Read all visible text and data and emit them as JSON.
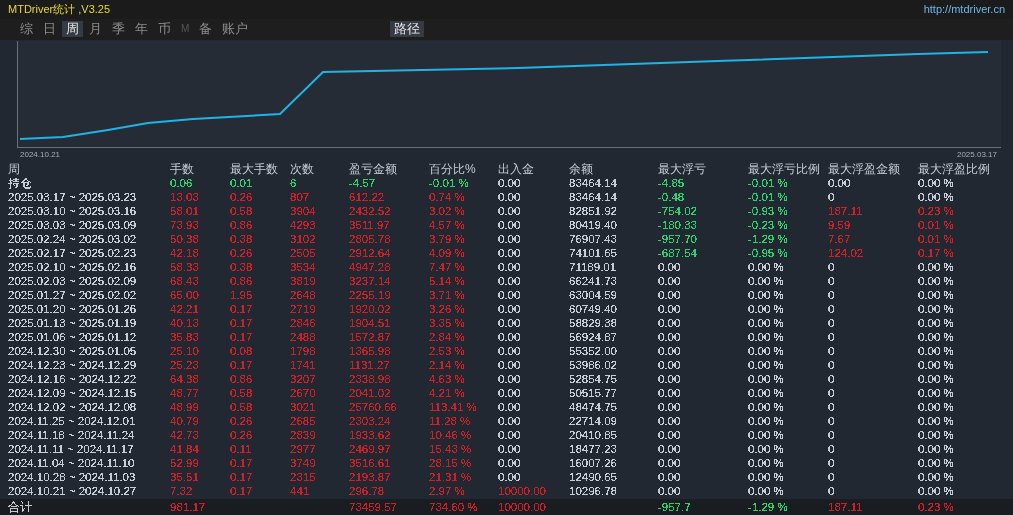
{
  "window": {
    "title": "MTDriver统计 ,V3.25",
    "link": "http://mtdriver.cn"
  },
  "tabs": [
    {
      "label": "综",
      "selected": false,
      "disabled": false
    },
    {
      "label": "日",
      "selected": false,
      "disabled": false
    },
    {
      "label": "周",
      "selected": true,
      "disabled": false
    },
    {
      "label": "月",
      "selected": false,
      "disabled": false
    },
    {
      "label": "季",
      "selected": false,
      "disabled": false
    },
    {
      "label": "年",
      "selected": false,
      "disabled": false
    },
    {
      "label": "币",
      "selected": false,
      "disabled": false
    },
    {
      "label": "M",
      "selected": false,
      "disabled": true
    },
    {
      "label": "备",
      "selected": false,
      "disabled": false
    },
    {
      "label": "账户",
      "selected": false,
      "disabled": false
    }
  ],
  "path_button": "路径",
  "chart": {
    "start_label": "2024.10.21",
    "end_label": "2025.03.17"
  },
  "table": {
    "columns": [
      "周",
      "手数",
      "最大手数",
      "次数",
      "盈亏金额",
      "百分比%",
      "出入金",
      "余额",
      "最大浮亏",
      "最大浮亏比例",
      "最大浮盈金额",
      "最大浮盈比例"
    ],
    "rows": [
      {
        "cells": [
          {
            "text": "持仓",
            "color": "#c8ccd4"
          },
          {
            "text": "0.06",
            "color": "#2ed16a"
          },
          {
            "text": "0.01",
            "color": "#2ed16a"
          },
          {
            "text": "6",
            "color": "#2ed16a"
          },
          {
            "text": "-4.57",
            "color": "#2ed16a"
          },
          {
            "text": "-0.01 %",
            "color": "#2ed16a"
          },
          {
            "text": "0.00",
            "color": "#c8ccd4"
          },
          {
            "text": "83464.14",
            "color": "#c8ccd4"
          },
          {
            "text": "-4.85",
            "color": "#2ed16a"
          },
          {
            "text": "-0.01 %",
            "color": "#2ed16a"
          },
          {
            "text": "0.00",
            "color": "#c8ccd4"
          },
          {
            "text": "0.00 %",
            "color": "#c8ccd4"
          }
        ]
      },
      {
        "cells": [
          {
            "text": "2025.03.17 ~ 2025.03.23",
            "color": "#c8ccd4"
          },
          {
            "text": "13.03",
            "color": "#cf2028"
          },
          {
            "text": "0.26",
            "color": "#cf2028"
          },
          {
            "text": "807",
            "color": "#cf2028"
          },
          {
            "text": "612.22",
            "color": "#cf2028"
          },
          {
            "text": "0.74 %",
            "color": "#cf2028"
          },
          {
            "text": "0.00",
            "color": "#c8ccd4"
          },
          {
            "text": "83464.14",
            "color": "#c8ccd4"
          },
          {
            "text": "-0.48",
            "color": "#2ed16a"
          },
          {
            "text": "-0.01 %",
            "color": "#2ed16a"
          },
          {
            "text": "0",
            "color": "#c8ccd4"
          },
          {
            "text": "0.00 %",
            "color": "#c8ccd4"
          }
        ]
      },
      {
        "cells": [
          {
            "text": "2025.03.10 ~ 2025.03.16",
            "color": "#c8ccd4"
          },
          {
            "text": "58.01",
            "color": "#cf2028"
          },
          {
            "text": "0.58",
            "color": "#cf2028"
          },
          {
            "text": "3904",
            "color": "#cf2028"
          },
          {
            "text": "2432.52",
            "color": "#cf2028"
          },
          {
            "text": "3.02 %",
            "color": "#cf2028"
          },
          {
            "text": "0.00",
            "color": "#c8ccd4"
          },
          {
            "text": "82851.92",
            "color": "#c8ccd4"
          },
          {
            "text": "-754.02",
            "color": "#2ed16a"
          },
          {
            "text": "-0.93 %",
            "color": "#2ed16a"
          },
          {
            "text": "187.11",
            "color": "#cf2028"
          },
          {
            "text": "0.23 %",
            "color": "#cf2028"
          }
        ]
      },
      {
        "cells": [
          {
            "text": "2025.03.03 ~ 2025.03.09",
            "color": "#c8ccd4"
          },
          {
            "text": "73.93",
            "color": "#cf2028"
          },
          {
            "text": "0.86",
            "color": "#cf2028"
          },
          {
            "text": "4293",
            "color": "#cf2028"
          },
          {
            "text": "3511.97",
            "color": "#cf2028"
          },
          {
            "text": "4.57 %",
            "color": "#cf2028"
          },
          {
            "text": "0.00",
            "color": "#c8ccd4"
          },
          {
            "text": "80419.40",
            "color": "#c8ccd4"
          },
          {
            "text": "-180.33",
            "color": "#2ed16a"
          },
          {
            "text": "-0.23 %",
            "color": "#2ed16a"
          },
          {
            "text": "9.59",
            "color": "#cf2028"
          },
          {
            "text": "0.01 %",
            "color": "#cf2028"
          }
        ]
      },
      {
        "cells": [
          {
            "text": "2025.02.24 ~ 2025.03.02",
            "color": "#c8ccd4"
          },
          {
            "text": "50.38",
            "color": "#cf2028"
          },
          {
            "text": "0.38",
            "color": "#cf2028"
          },
          {
            "text": "3102",
            "color": "#cf2028"
          },
          {
            "text": "2805.78",
            "color": "#cf2028"
          },
          {
            "text": "3.79 %",
            "color": "#cf2028"
          },
          {
            "text": "0.00",
            "color": "#c8ccd4"
          },
          {
            "text": "76907.43",
            "color": "#c8ccd4"
          },
          {
            "text": "-957.70",
            "color": "#2ed16a"
          },
          {
            "text": "-1.29 %",
            "color": "#2ed16a"
          },
          {
            "text": "7.67",
            "color": "#cf2028"
          },
          {
            "text": "0.01 %",
            "color": "#cf2028"
          }
        ]
      },
      {
        "cells": [
          {
            "text": "2025.02.17 ~ 2025.02.23",
            "color": "#c8ccd4"
          },
          {
            "text": "42.18",
            "color": "#cf2028"
          },
          {
            "text": "0.26",
            "color": "#cf2028"
          },
          {
            "text": "2505",
            "color": "#cf2028"
          },
          {
            "text": "2912.64",
            "color": "#cf2028"
          },
          {
            "text": "4.09 %",
            "color": "#cf2028"
          },
          {
            "text": "0.00",
            "color": "#c8ccd4"
          },
          {
            "text": "74101.65",
            "color": "#c8ccd4"
          },
          {
            "text": "-687.54",
            "color": "#2ed16a"
          },
          {
            "text": "-0.95 %",
            "color": "#2ed16a"
          },
          {
            "text": "124.02",
            "color": "#cf2028"
          },
          {
            "text": "0.17 %",
            "color": "#cf2028"
          }
        ]
      },
      {
        "cells": [
          {
            "text": "2025.02.10 ~ 2025.02.16",
            "color": "#c8ccd4"
          },
          {
            "text": "58.33",
            "color": "#cf2028"
          },
          {
            "text": "0.38",
            "color": "#cf2028"
          },
          {
            "text": "3534",
            "color": "#cf2028"
          },
          {
            "text": "4947.28",
            "color": "#cf2028"
          },
          {
            "text": "7.47 %",
            "color": "#cf2028"
          },
          {
            "text": "0.00",
            "color": "#c8ccd4"
          },
          {
            "text": "71189.01",
            "color": "#c8ccd4"
          },
          {
            "text": "0.00",
            "color": "#c8ccd4"
          },
          {
            "text": "0.00 %",
            "color": "#c8ccd4"
          },
          {
            "text": "0",
            "color": "#c8ccd4"
          },
          {
            "text": "0.00 %",
            "color": "#c8ccd4"
          }
        ]
      },
      {
        "cells": [
          {
            "text": "2025.02.03 ~ 2025.02.09",
            "color": "#c8ccd4"
          },
          {
            "text": "68.43",
            "color": "#cf2028"
          },
          {
            "text": "0.86",
            "color": "#cf2028"
          },
          {
            "text": "3819",
            "color": "#cf2028"
          },
          {
            "text": "3237.14",
            "color": "#cf2028"
          },
          {
            "text": "5.14 %",
            "color": "#cf2028"
          },
          {
            "text": "0.00",
            "color": "#c8ccd4"
          },
          {
            "text": "66241.73",
            "color": "#c8ccd4"
          },
          {
            "text": "0.00",
            "color": "#c8ccd4"
          },
          {
            "text": "0.00 %",
            "color": "#c8ccd4"
          },
          {
            "text": "0",
            "color": "#c8ccd4"
          },
          {
            "text": "0.00 %",
            "color": "#c8ccd4"
          }
        ]
      },
      {
        "cells": [
          {
            "text": "2025.01.27 ~ 2025.02.02",
            "color": "#c8ccd4"
          },
          {
            "text": "65.00",
            "color": "#cf2028"
          },
          {
            "text": "1.95",
            "color": "#cf2028"
          },
          {
            "text": "2648",
            "color": "#cf2028"
          },
          {
            "text": "2255.19",
            "color": "#cf2028"
          },
          {
            "text": "3.71 %",
            "color": "#cf2028"
          },
          {
            "text": "0.00",
            "color": "#c8ccd4"
          },
          {
            "text": "63004.59",
            "color": "#c8ccd4"
          },
          {
            "text": "0.00",
            "color": "#c8ccd4"
          },
          {
            "text": "0.00 %",
            "color": "#c8ccd4"
          },
          {
            "text": "0",
            "color": "#c8ccd4"
          },
          {
            "text": "0.00 %",
            "color": "#c8ccd4"
          }
        ]
      },
      {
        "cells": [
          {
            "text": "2025.01.20 ~ 2025.01.26",
            "color": "#c8ccd4"
          },
          {
            "text": "42.21",
            "color": "#cf2028"
          },
          {
            "text": "0.17",
            "color": "#cf2028"
          },
          {
            "text": "2719",
            "color": "#cf2028"
          },
          {
            "text": "1920.02",
            "color": "#cf2028"
          },
          {
            "text": "3.26 %",
            "color": "#cf2028"
          },
          {
            "text": "0.00",
            "color": "#c8ccd4"
          },
          {
            "text": "60749.40",
            "color": "#c8ccd4"
          },
          {
            "text": "0.00",
            "color": "#c8ccd4"
          },
          {
            "text": "0.00 %",
            "color": "#c8ccd4"
          },
          {
            "text": "0",
            "color": "#c8ccd4"
          },
          {
            "text": "0.00 %",
            "color": "#c8ccd4"
          }
        ]
      },
      {
        "cells": [
          {
            "text": "2025.01.13 ~ 2025.01.19",
            "color": "#c8ccd4"
          },
          {
            "text": "40.13",
            "color": "#cf2028"
          },
          {
            "text": "0.17",
            "color": "#cf2028"
          },
          {
            "text": "2846",
            "color": "#cf2028"
          },
          {
            "text": "1904.51",
            "color": "#cf2028"
          },
          {
            "text": "3.35 %",
            "color": "#cf2028"
          },
          {
            "text": "0.00",
            "color": "#c8ccd4"
          },
          {
            "text": "58829.38",
            "color": "#c8ccd4"
          },
          {
            "text": "0.00",
            "color": "#c8ccd4"
          },
          {
            "text": "0.00 %",
            "color": "#c8ccd4"
          },
          {
            "text": "0",
            "color": "#c8ccd4"
          },
          {
            "text": "0.00 %",
            "color": "#c8ccd4"
          }
        ]
      },
      {
        "cells": [
          {
            "text": "2025.01.06 ~ 2025.01.12",
            "color": "#c8ccd4"
          },
          {
            "text": "35.83",
            "color": "#cf2028"
          },
          {
            "text": "0.17",
            "color": "#cf2028"
          },
          {
            "text": "2488",
            "color": "#cf2028"
          },
          {
            "text": "1572.87",
            "color": "#cf2028"
          },
          {
            "text": "2.84 %",
            "color": "#cf2028"
          },
          {
            "text": "0.00",
            "color": "#c8ccd4"
          },
          {
            "text": "56924.87",
            "color": "#c8ccd4"
          },
          {
            "text": "0.00",
            "color": "#c8ccd4"
          },
          {
            "text": "0.00 %",
            "color": "#c8ccd4"
          },
          {
            "text": "0",
            "color": "#c8ccd4"
          },
          {
            "text": "0.00 %",
            "color": "#c8ccd4"
          }
        ]
      },
      {
        "cells": [
          {
            "text": "2024.12.30 ~ 2025.01.05",
            "color": "#c8ccd4"
          },
          {
            "text": "25.10",
            "color": "#cf2028"
          },
          {
            "text": "0.08",
            "color": "#cf2028"
          },
          {
            "text": "1798",
            "color": "#cf2028"
          },
          {
            "text": "1365.98",
            "color": "#cf2028"
          },
          {
            "text": "2.53 %",
            "color": "#cf2028"
          },
          {
            "text": "0.00",
            "color": "#c8ccd4"
          },
          {
            "text": "55352.00",
            "color": "#c8ccd4"
          },
          {
            "text": "0.00",
            "color": "#c8ccd4"
          },
          {
            "text": "0.00 %",
            "color": "#c8ccd4"
          },
          {
            "text": "0",
            "color": "#c8ccd4"
          },
          {
            "text": "0.00 %",
            "color": "#c8ccd4"
          }
        ]
      },
      {
        "cells": [
          {
            "text": "2024.12.23 ~ 2024.12.29",
            "color": "#c8ccd4"
          },
          {
            "text": "25.23",
            "color": "#cf2028"
          },
          {
            "text": "0.17",
            "color": "#cf2028"
          },
          {
            "text": "1741",
            "color": "#cf2028"
          },
          {
            "text": "1131.27",
            "color": "#cf2028"
          },
          {
            "text": "2.14 %",
            "color": "#cf2028"
          },
          {
            "text": "0.00",
            "color": "#c8ccd4"
          },
          {
            "text": "53986.02",
            "color": "#c8ccd4"
          },
          {
            "text": "0.00",
            "color": "#c8ccd4"
          },
          {
            "text": "0.00 %",
            "color": "#c8ccd4"
          },
          {
            "text": "0",
            "color": "#c8ccd4"
          },
          {
            "text": "0.00 %",
            "color": "#c8ccd4"
          }
        ]
      },
      {
        "cells": [
          {
            "text": "2024.12.16 ~ 2024.12.22",
            "color": "#c8ccd4"
          },
          {
            "text": "64.38",
            "color": "#cf2028"
          },
          {
            "text": "0.86",
            "color": "#cf2028"
          },
          {
            "text": "3207",
            "color": "#cf2028"
          },
          {
            "text": "2338.98",
            "color": "#cf2028"
          },
          {
            "text": "4.63 %",
            "color": "#cf2028"
          },
          {
            "text": "0.00",
            "color": "#c8ccd4"
          },
          {
            "text": "52854.75",
            "color": "#c8ccd4"
          },
          {
            "text": "0.00",
            "color": "#c8ccd4"
          },
          {
            "text": "0.00 %",
            "color": "#c8ccd4"
          },
          {
            "text": "0",
            "color": "#c8ccd4"
          },
          {
            "text": "0.00 %",
            "color": "#c8ccd4"
          }
        ]
      },
      {
        "cells": [
          {
            "text": "2024.12.09 ~ 2024.12.15",
            "color": "#c8ccd4"
          },
          {
            "text": "48.77",
            "color": "#cf2028"
          },
          {
            "text": "0.58",
            "color": "#cf2028"
          },
          {
            "text": "2670",
            "color": "#cf2028"
          },
          {
            "text": "2041.02",
            "color": "#cf2028"
          },
          {
            "text": "4.21 %",
            "color": "#cf2028"
          },
          {
            "text": "0.00",
            "color": "#c8ccd4"
          },
          {
            "text": "50515.77",
            "color": "#c8ccd4"
          },
          {
            "text": "0.00",
            "color": "#c8ccd4"
          },
          {
            "text": "0.00 %",
            "color": "#c8ccd4"
          },
          {
            "text": "0",
            "color": "#c8ccd4"
          },
          {
            "text": "0.00 %",
            "color": "#c8ccd4"
          }
        ]
      },
      {
        "cells": [
          {
            "text": "2024.12.02 ~ 2024.12.08",
            "color": "#c8ccd4"
          },
          {
            "text": "48.99",
            "color": "#cf2028"
          },
          {
            "text": "0.58",
            "color": "#cf2028"
          },
          {
            "text": "3021",
            "color": "#cf2028"
          },
          {
            "text": "25760.66",
            "color": "#cf2028"
          },
          {
            "text": "113.41 %",
            "color": "#cf2028"
          },
          {
            "text": "0.00",
            "color": "#c8ccd4"
          },
          {
            "text": "48474.75",
            "color": "#c8ccd4"
          },
          {
            "text": "0.00",
            "color": "#c8ccd4"
          },
          {
            "text": "0.00 %",
            "color": "#c8ccd4"
          },
          {
            "text": "0",
            "color": "#c8ccd4"
          },
          {
            "text": "0.00 %",
            "color": "#c8ccd4"
          }
        ]
      },
      {
        "cells": [
          {
            "text": "2024.11.25 ~ 2024.12.01",
            "color": "#c8ccd4"
          },
          {
            "text": "40.79",
            "color": "#cf2028"
          },
          {
            "text": "0.26",
            "color": "#cf2028"
          },
          {
            "text": "2685",
            "color": "#cf2028"
          },
          {
            "text": "2303.24",
            "color": "#cf2028"
          },
          {
            "text": "11.28 %",
            "color": "#cf2028"
          },
          {
            "text": "0.00",
            "color": "#c8ccd4"
          },
          {
            "text": "22714.09",
            "color": "#c8ccd4"
          },
          {
            "text": "0.00",
            "color": "#c8ccd4"
          },
          {
            "text": "0.00 %",
            "color": "#c8ccd4"
          },
          {
            "text": "0",
            "color": "#c8ccd4"
          },
          {
            "text": "0.00 %",
            "color": "#c8ccd4"
          }
        ]
      },
      {
        "cells": [
          {
            "text": "2024.11.18 ~ 2024.11.24",
            "color": "#c8ccd4"
          },
          {
            "text": "42.73",
            "color": "#cf2028"
          },
          {
            "text": "0.26",
            "color": "#cf2028"
          },
          {
            "text": "2839",
            "color": "#cf2028"
          },
          {
            "text": "1933.62",
            "color": "#cf2028"
          },
          {
            "text": "10.46 %",
            "color": "#cf2028"
          },
          {
            "text": "0.00",
            "color": "#c8ccd4"
          },
          {
            "text": "20410.85",
            "color": "#c8ccd4"
          },
          {
            "text": "0.00",
            "color": "#c8ccd4"
          },
          {
            "text": "0.00 %",
            "color": "#c8ccd4"
          },
          {
            "text": "0",
            "color": "#c8ccd4"
          },
          {
            "text": "0.00 %",
            "color": "#c8ccd4"
          }
        ]
      },
      {
        "cells": [
          {
            "text": "2024.11.11 ~ 2024.11.17",
            "color": "#c8ccd4"
          },
          {
            "text": "41.84",
            "color": "#cf2028"
          },
          {
            "text": "0.11",
            "color": "#cf2028"
          },
          {
            "text": "2977",
            "color": "#cf2028"
          },
          {
            "text": "2469.97",
            "color": "#cf2028"
          },
          {
            "text": "15.43 %",
            "color": "#cf2028"
          },
          {
            "text": "0.00",
            "color": "#c8ccd4"
          },
          {
            "text": "18477.23",
            "color": "#c8ccd4"
          },
          {
            "text": "0.00",
            "color": "#c8ccd4"
          },
          {
            "text": "0.00 %",
            "color": "#c8ccd4"
          },
          {
            "text": "0",
            "color": "#c8ccd4"
          },
          {
            "text": "0.00 %",
            "color": "#c8ccd4"
          }
        ]
      },
      {
        "cells": [
          {
            "text": "2024.11.04 ~ 2024.11.10",
            "color": "#c8ccd4"
          },
          {
            "text": "52.99",
            "color": "#cf2028"
          },
          {
            "text": "0.17",
            "color": "#cf2028"
          },
          {
            "text": "3749",
            "color": "#cf2028"
          },
          {
            "text": "3516.61",
            "color": "#cf2028"
          },
          {
            "text": "28.15 %",
            "color": "#cf2028"
          },
          {
            "text": "0.00",
            "color": "#c8ccd4"
          },
          {
            "text": "16007.26",
            "color": "#c8ccd4"
          },
          {
            "text": "0.00",
            "color": "#c8ccd4"
          },
          {
            "text": "0.00 %",
            "color": "#c8ccd4"
          },
          {
            "text": "0",
            "color": "#c8ccd4"
          },
          {
            "text": "0.00 %",
            "color": "#c8ccd4"
          }
        ]
      },
      {
        "cells": [
          {
            "text": "2024.10.28 ~ 2024.11.03",
            "color": "#c8ccd4"
          },
          {
            "text": "35.51",
            "color": "#cf2028"
          },
          {
            "text": "0.17",
            "color": "#cf2028"
          },
          {
            "text": "2315",
            "color": "#cf2028"
          },
          {
            "text": "2193.87",
            "color": "#cf2028"
          },
          {
            "text": "21.31 %",
            "color": "#cf2028"
          },
          {
            "text": "0.00",
            "color": "#c8ccd4"
          },
          {
            "text": "12490.65",
            "color": "#c8ccd4"
          },
          {
            "text": "0.00",
            "color": "#c8ccd4"
          },
          {
            "text": "0.00 %",
            "color": "#c8ccd4"
          },
          {
            "text": "0",
            "color": "#c8ccd4"
          },
          {
            "text": "0.00 %",
            "color": "#c8ccd4"
          }
        ]
      },
      {
        "cells": [
          {
            "text": "2024.10.21 ~ 2024.10.27",
            "color": "#c8ccd4"
          },
          {
            "text": "7.32",
            "color": "#cf2028"
          },
          {
            "text": "0.17",
            "color": "#cf2028"
          },
          {
            "text": "441",
            "color": "#cf2028"
          },
          {
            "text": "296.78",
            "color": "#cf2028"
          },
          {
            "text": "2.97 %",
            "color": "#cf2028"
          },
          {
            "text": "10000.00",
            "color": "#cf2028"
          },
          {
            "text": "10296.78",
            "color": "#c8ccd4"
          },
          {
            "text": "0.00",
            "color": "#c8ccd4"
          },
          {
            "text": "0.00 %",
            "color": "#c8ccd4"
          },
          {
            "text": "0",
            "color": "#c8ccd4"
          },
          {
            "text": "0.00 %",
            "color": "#c8ccd4"
          }
        ]
      }
    ],
    "total": {
      "cells": [
        {
          "text": "合计",
          "color": "#c8ccd4"
        },
        {
          "text": "981.17",
          "color": "#cf2028"
        },
        null,
        null,
        {
          "text": "73459.57",
          "color": "#cf2028"
        },
        {
          "text": "734.60 %",
          "color": "#cf2028"
        },
        {
          "text": "10000.00",
          "color": "#cf2028"
        },
        null,
        {
          "text": "-957.7",
          "color": "#2ed16a"
        },
        {
          "text": "-1.29 %",
          "color": "#2ed16a"
        },
        {
          "text": "187.11",
          "color": "#cf2028"
        },
        {
          "text": "0.23 %",
          "color": "#cf2028"
        }
      ]
    }
  }
}
